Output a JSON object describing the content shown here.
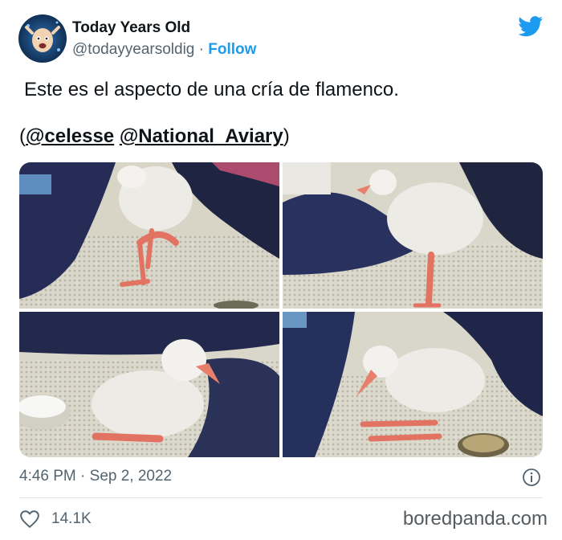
{
  "author": {
    "display_name": "Today Years Old",
    "handle": "@todayyearsoldig",
    "separator": "·",
    "follow_label": "Follow",
    "avatar_icon": "face-avatar-icon"
  },
  "brand_icon": "twitter-bird-icon",
  "tweet": {
    "text": "Este es el aspecto de una cría de flamenco.",
    "open_paren": "(",
    "mention_1": "@celesse",
    "space": " ",
    "mention_2": "@National_Aviary",
    "close_paren": ")"
  },
  "photos": [
    {
      "subject": "flamingo-chick-standing-one-leg"
    },
    {
      "subject": "flamingo-chick-standing-side"
    },
    {
      "subject": "flamingo-chick-sitting"
    },
    {
      "subject": "flamingo-chick-crouching"
    }
  ],
  "footer": {
    "timestamp": "4:46 PM · Sep 2, 2022",
    "like_count": "14.1K",
    "info_icon": "info-icon",
    "heart_icon": "heart-icon"
  },
  "watermark": "boredpanda.com",
  "colors": {
    "accent": "#1d9bf0",
    "text_primary": "#0f1419",
    "text_secondary": "#536471"
  }
}
